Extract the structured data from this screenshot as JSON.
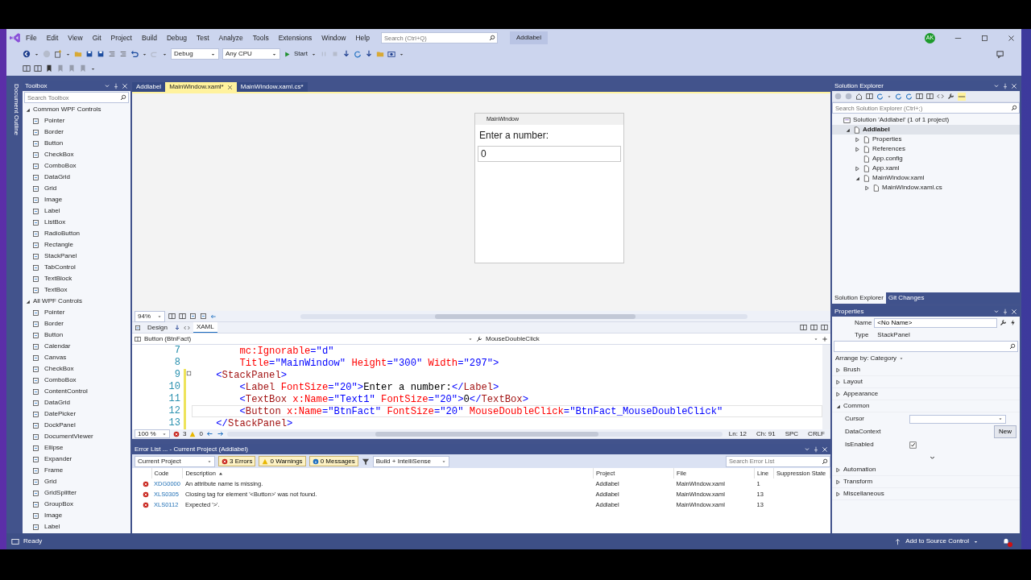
{
  "menu": [
    "File",
    "Edit",
    "View",
    "Git",
    "Project",
    "Build",
    "Debug",
    "Test",
    "Analyze",
    "Tools",
    "Extensions",
    "Window",
    "Help"
  ],
  "search": {
    "placeholder": "Search (Ctrl+Q)"
  },
  "solution_title": "Addlabel",
  "account": {
    "initials": "AK"
  },
  "toolbar": {
    "configuration": "Debug",
    "platform": "Any CPU",
    "start": "Start"
  },
  "side_tab": "Document Outline",
  "toolbox": {
    "title": "Toolbox",
    "search": {
      "placeholder": "Search Toolbox"
    },
    "groups": [
      {
        "label": "Common WPF Controls",
        "expanded": true,
        "items": [
          "Pointer",
          "Border",
          "Button",
          "CheckBox",
          "ComboBox",
          "DataGrid",
          "Grid",
          "Image",
          "Label",
          "ListBox",
          "RadioButton",
          "Rectangle",
          "StackPanel",
          "TabControl",
          "TextBlock",
          "TextBox"
        ]
      },
      {
        "label": "All WPF Controls",
        "expanded": true,
        "items": [
          "Pointer",
          "Border",
          "Button",
          "Calendar",
          "Canvas",
          "CheckBox",
          "ComboBox",
          "ContentControl",
          "DataGrid",
          "DatePicker",
          "DockPanel",
          "DocumentViewer",
          "Ellipse",
          "Expander",
          "Frame",
          "Grid",
          "GridSplitter",
          "GroupBox",
          "Image",
          "Label"
        ]
      }
    ]
  },
  "doc_tabs": [
    {
      "label": "Addlabel",
      "selected": false
    },
    {
      "label": "MainWindow.xaml*",
      "selected": true
    },
    {
      "label": "MainWindow.xaml.cs*",
      "selected": false
    }
  ],
  "designer": {
    "window_title": "MainWindow",
    "label": "Enter a number:",
    "textbox": "0",
    "zoom": "94%"
  },
  "view_tabs": [
    {
      "label": "Design",
      "selected": false
    },
    {
      "label": "XAML",
      "selected": true
    }
  ],
  "editor": {
    "element": "Button (BtnFact)",
    "event": "MouseDoubleClick",
    "lines": [
      {
        "number": "7",
        "modified": false,
        "current": false,
        "foldable": false,
        "tokens": [
          {
            "kind": "attr",
            "text": "        mc:Ignorable"
          },
          {
            "kind": "op",
            "text": "="
          },
          {
            "kind": "value",
            "text": "\"d\""
          }
        ]
      },
      {
        "number": "8",
        "modified": false,
        "current": false,
        "foldable": false,
        "tokens": [
          {
            "kind": "attr",
            "text": "        Title"
          },
          {
            "kind": "op",
            "text": "="
          },
          {
            "kind": "value",
            "text": "\"MainWindow\""
          },
          {
            "kind": "attr",
            "text": " Height"
          },
          {
            "kind": "op",
            "text": "="
          },
          {
            "kind": "value",
            "text": "\"300\""
          },
          {
            "kind": "attr",
            "text": " Width"
          },
          {
            "kind": "op",
            "text": "="
          },
          {
            "kind": "value",
            "text": "\"297\""
          },
          {
            "kind": "bracket",
            "text": ">"
          }
        ]
      },
      {
        "number": "9",
        "modified": true,
        "current": false,
        "foldable": true,
        "tokens": [
          {
            "kind": "bracket",
            "text": "    <"
          },
          {
            "kind": "tag",
            "text": "StackPanel"
          },
          {
            "kind": "bracket",
            "text": ">"
          }
        ]
      },
      {
        "number": "10",
        "modified": true,
        "current": false,
        "foldable": false,
        "tokens": [
          {
            "kind": "bracket",
            "text": "        <"
          },
          {
            "kind": "tag",
            "text": "Label"
          },
          {
            "kind": "attr",
            "text": " FontSize"
          },
          {
            "kind": "op",
            "text": "="
          },
          {
            "kind": "value",
            "text": "\"20\""
          },
          {
            "kind": "bracket",
            "text": ">"
          },
          {
            "kind": "text",
            "text": "Enter a number:"
          },
          {
            "kind": "bracket",
            "text": "</"
          },
          {
            "kind": "tag",
            "text": "Label"
          },
          {
            "kind": "bracket",
            "text": ">"
          }
        ]
      },
      {
        "number": "11",
        "modified": true,
        "current": false,
        "foldable": false,
        "tokens": [
          {
            "kind": "bracket",
            "text": "        <"
          },
          {
            "kind": "tag",
            "text": "TextBox"
          },
          {
            "kind": "attr",
            "text": " x:Name"
          },
          {
            "kind": "op",
            "text": "="
          },
          {
            "kind": "value",
            "text": "\"Text1\""
          },
          {
            "kind": "attr",
            "text": " FontSize"
          },
          {
            "kind": "op",
            "text": "="
          },
          {
            "kind": "value",
            "text": "\"20\""
          },
          {
            "kind": "bracket",
            "text": ">"
          },
          {
            "kind": "text",
            "text": "0"
          },
          {
            "kind": "bracket",
            "text": "</"
          },
          {
            "kind": "tag",
            "text": "TextBox"
          },
          {
            "kind": "bracket",
            "text": ">"
          }
        ]
      },
      {
        "number": "12",
        "modified": true,
        "current": true,
        "foldable": false,
        "tokens": [
          {
            "kind": "bracket",
            "text": "        <"
          },
          {
            "kind": "tag",
            "text": "Button"
          },
          {
            "kind": "attr",
            "text": " x:Name"
          },
          {
            "kind": "op",
            "text": "="
          },
          {
            "kind": "value",
            "text": "\"BtnFact\""
          },
          {
            "kind": "attr",
            "text": " FontSize"
          },
          {
            "kind": "op",
            "text": "="
          },
          {
            "kind": "value",
            "text": "\"20\""
          },
          {
            "kind": "attr",
            "text": " MouseDoubleClick"
          },
          {
            "kind": "op",
            "text": "="
          },
          {
            "kind": "value",
            "text": "\"BtnFact_MouseDoubleClick\""
          }
        ]
      },
      {
        "number": "13",
        "modified": true,
        "current": false,
        "foldable": false,
        "tokens": [
          {
            "kind": "bracket",
            "text": "    </"
          },
          {
            "kind": "tag",
            "text": "StackPanel"
          },
          {
            "kind": "bracket",
            "text": ">"
          }
        ]
      }
    ],
    "status": {
      "zoom": "100 %",
      "errors": "3",
      "warnings": "0",
      "line": "Ln: 12",
      "column": "Ch: 91",
      "whitespace": "SPC",
      "line_ending": "CRLF"
    }
  },
  "error_list": {
    "title": "Error List ... - Current Project (Addlabel)",
    "scope": "Current Project",
    "filters": [
      {
        "label": "3 Errors",
        "kind": "error"
      },
      {
        "label": "0 Warnings",
        "kind": "warning"
      },
      {
        "label": "0 Messages",
        "kind": "message"
      }
    ],
    "source": "Build + IntelliSense",
    "search": {
      "placeholder": "Search Error List"
    },
    "columns": [
      "Code",
      "Description",
      "Project",
      "File",
      "Line",
      "Suppression State"
    ],
    "rows": [
      {
        "code": "XDG0000",
        "description": "An attribute name is missing.",
        "project": "Addlabel",
        "file": "MainWindow.xaml",
        "line": "1"
      },
      {
        "code": "XLS0305",
        "description": "Closing tag for element '<Button>' was not found.",
        "project": "Addlabel",
        "file": "MainWindow.xaml",
        "line": "13"
      },
      {
        "code": "XLS0112",
        "description": "Expected '>'.",
        "project": "Addlabel",
        "file": "MainWindow.xaml",
        "line": "13"
      }
    ]
  },
  "solution_explorer": {
    "title": "Solution Explorer",
    "search": {
      "placeholder": "Search Solution Explorer (Ctrl+;)"
    },
    "tree": [
      {
        "label": "Solution 'Addlabel' (1 of 1 project)",
        "selected": false,
        "children": [
          {
            "label": "Addlabel",
            "selected": true,
            "expanded": true,
            "children": [
              {
                "label": "Properties",
                "selected": false,
                "expanded": false
              },
              {
                "label": "References",
                "selected": false,
                "expanded": false
              },
              {
                "label": "App.config",
                "selected": false
              },
              {
                "label": "App.xaml",
                "selected": false,
                "expanded": false
              },
              {
                "label": "MainWindow.xaml",
                "selected": false,
                "expanded": true,
                "children": [
                  {
                    "label": "MainWindow.xaml.cs",
                    "selected": false,
                    "expanded": false
                  }
                ]
              }
            ]
          }
        ]
      }
    ],
    "tabs": [
      {
        "label": "Solution Explorer",
        "selected": true
      },
      {
        "label": "Git Changes",
        "selected": false
      }
    ]
  },
  "properties": {
    "title": "Properties",
    "name_label": "Name",
    "name_value": "<No Name>",
    "type_label": "Type",
    "type_value": "StackPanel",
    "arrange": "Arrange by: Category",
    "categories": [
      {
        "label": "Brush",
        "expanded": false
      },
      {
        "label": "Layout",
        "expanded": false
      },
      {
        "label": "Appearance",
        "expanded": false
      },
      {
        "label": "Common",
        "expanded": true,
        "items": [
          {
            "label": "Cursor",
            "kind": "dropdown"
          },
          {
            "label": "DataContext",
            "kind": "button",
            "button": "New"
          },
          {
            "label": "IsEnabled",
            "kind": "checkbox",
            "checked": true
          }
        ]
      },
      {
        "label": "Automation",
        "expanded": false
      },
      {
        "label": "Transform",
        "expanded": false
      },
      {
        "label": "Miscellaneous",
        "expanded": false
      }
    ]
  },
  "status_bar": {
    "text": "Ready",
    "source_control": "Add to Source Control"
  }
}
